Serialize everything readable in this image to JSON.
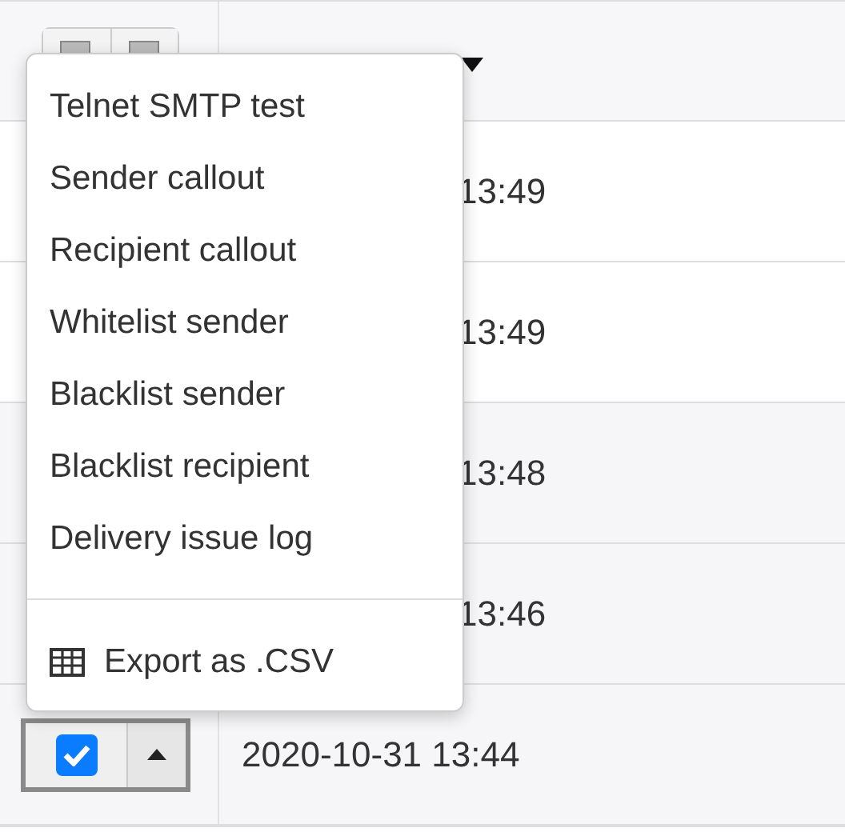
{
  "table": {
    "rows": [
      {
        "kind": "partial",
        "time": "13:49"
      },
      {
        "kind": "partial",
        "time": "13:49"
      },
      {
        "kind": "partial",
        "time": "13:48"
      },
      {
        "kind": "partial",
        "time": "13:46"
      },
      {
        "kind": "full",
        "time": "2020-10-31 13:44",
        "selector": {
          "checked": true
        }
      }
    ]
  },
  "menu": {
    "items": [
      {
        "kind": "action",
        "label": "Telnet SMTP test"
      },
      {
        "kind": "action",
        "label": "Sender callout"
      },
      {
        "kind": "action",
        "label": "Recipient callout"
      },
      {
        "kind": "action",
        "label": "Whitelist sender"
      },
      {
        "kind": "action",
        "label": "Blacklist sender"
      },
      {
        "kind": "action",
        "label": "Blacklist recipient"
      },
      {
        "kind": "action",
        "label": "Delivery issue log"
      },
      {
        "kind": "divider"
      },
      {
        "kind": "export",
        "label": "Export as .CSV"
      }
    ]
  }
}
